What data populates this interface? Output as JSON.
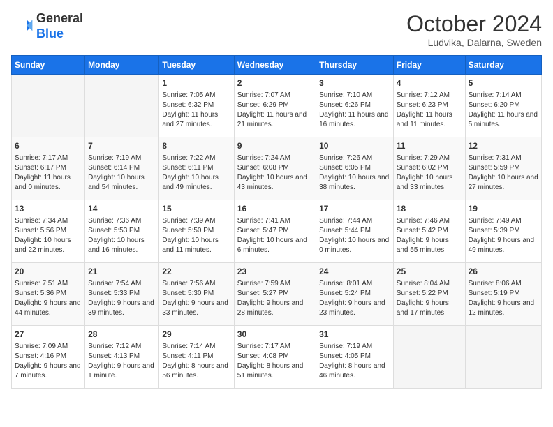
{
  "header": {
    "logo_line1": "General",
    "logo_line2": "Blue",
    "month": "October 2024",
    "location": "Ludvika, Dalarna, Sweden"
  },
  "days_of_week": [
    "Sunday",
    "Monday",
    "Tuesday",
    "Wednesday",
    "Thursday",
    "Friday",
    "Saturday"
  ],
  "weeks": [
    [
      {
        "day": "",
        "info": ""
      },
      {
        "day": "",
        "info": ""
      },
      {
        "day": "1",
        "info": "Sunrise: 7:05 AM\nSunset: 6:32 PM\nDaylight: 11 hours and 27 minutes."
      },
      {
        "day": "2",
        "info": "Sunrise: 7:07 AM\nSunset: 6:29 PM\nDaylight: 11 hours and 21 minutes."
      },
      {
        "day": "3",
        "info": "Sunrise: 7:10 AM\nSunset: 6:26 PM\nDaylight: 11 hours and 16 minutes."
      },
      {
        "day": "4",
        "info": "Sunrise: 7:12 AM\nSunset: 6:23 PM\nDaylight: 11 hours and 11 minutes."
      },
      {
        "day": "5",
        "info": "Sunrise: 7:14 AM\nSunset: 6:20 PM\nDaylight: 11 hours and 5 minutes."
      }
    ],
    [
      {
        "day": "6",
        "info": "Sunrise: 7:17 AM\nSunset: 6:17 PM\nDaylight: 11 hours and 0 minutes."
      },
      {
        "day": "7",
        "info": "Sunrise: 7:19 AM\nSunset: 6:14 PM\nDaylight: 10 hours and 54 minutes."
      },
      {
        "day": "8",
        "info": "Sunrise: 7:22 AM\nSunset: 6:11 PM\nDaylight: 10 hours and 49 minutes."
      },
      {
        "day": "9",
        "info": "Sunrise: 7:24 AM\nSunset: 6:08 PM\nDaylight: 10 hours and 43 minutes."
      },
      {
        "day": "10",
        "info": "Sunrise: 7:26 AM\nSunset: 6:05 PM\nDaylight: 10 hours and 38 minutes."
      },
      {
        "day": "11",
        "info": "Sunrise: 7:29 AM\nSunset: 6:02 PM\nDaylight: 10 hours and 33 minutes."
      },
      {
        "day": "12",
        "info": "Sunrise: 7:31 AM\nSunset: 5:59 PM\nDaylight: 10 hours and 27 minutes."
      }
    ],
    [
      {
        "day": "13",
        "info": "Sunrise: 7:34 AM\nSunset: 5:56 PM\nDaylight: 10 hours and 22 minutes."
      },
      {
        "day": "14",
        "info": "Sunrise: 7:36 AM\nSunset: 5:53 PM\nDaylight: 10 hours and 16 minutes."
      },
      {
        "day": "15",
        "info": "Sunrise: 7:39 AM\nSunset: 5:50 PM\nDaylight: 10 hours and 11 minutes."
      },
      {
        "day": "16",
        "info": "Sunrise: 7:41 AM\nSunset: 5:47 PM\nDaylight: 10 hours and 6 minutes."
      },
      {
        "day": "17",
        "info": "Sunrise: 7:44 AM\nSunset: 5:44 PM\nDaylight: 10 hours and 0 minutes."
      },
      {
        "day": "18",
        "info": "Sunrise: 7:46 AM\nSunset: 5:42 PM\nDaylight: 9 hours and 55 minutes."
      },
      {
        "day": "19",
        "info": "Sunrise: 7:49 AM\nSunset: 5:39 PM\nDaylight: 9 hours and 49 minutes."
      }
    ],
    [
      {
        "day": "20",
        "info": "Sunrise: 7:51 AM\nSunset: 5:36 PM\nDaylight: 9 hours and 44 minutes."
      },
      {
        "day": "21",
        "info": "Sunrise: 7:54 AM\nSunset: 5:33 PM\nDaylight: 9 hours and 39 minutes."
      },
      {
        "day": "22",
        "info": "Sunrise: 7:56 AM\nSunset: 5:30 PM\nDaylight: 9 hours and 33 minutes."
      },
      {
        "day": "23",
        "info": "Sunrise: 7:59 AM\nSunset: 5:27 PM\nDaylight: 9 hours and 28 minutes."
      },
      {
        "day": "24",
        "info": "Sunrise: 8:01 AM\nSunset: 5:24 PM\nDaylight: 9 hours and 23 minutes."
      },
      {
        "day": "25",
        "info": "Sunrise: 8:04 AM\nSunset: 5:22 PM\nDaylight: 9 hours and 17 minutes."
      },
      {
        "day": "26",
        "info": "Sunrise: 8:06 AM\nSunset: 5:19 PM\nDaylight: 9 hours and 12 minutes."
      }
    ],
    [
      {
        "day": "27",
        "info": "Sunrise: 7:09 AM\nSunset: 4:16 PM\nDaylight: 9 hours and 7 minutes."
      },
      {
        "day": "28",
        "info": "Sunrise: 7:12 AM\nSunset: 4:13 PM\nDaylight: 9 hours and 1 minute."
      },
      {
        "day": "29",
        "info": "Sunrise: 7:14 AM\nSunset: 4:11 PM\nDaylight: 8 hours and 56 minutes."
      },
      {
        "day": "30",
        "info": "Sunrise: 7:17 AM\nSunset: 4:08 PM\nDaylight: 8 hours and 51 minutes."
      },
      {
        "day": "31",
        "info": "Sunrise: 7:19 AM\nSunset: 4:05 PM\nDaylight: 8 hours and 46 minutes."
      },
      {
        "day": "",
        "info": ""
      },
      {
        "day": "",
        "info": ""
      }
    ]
  ]
}
